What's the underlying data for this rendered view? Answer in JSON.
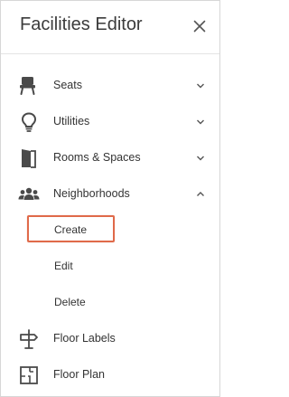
{
  "header": {
    "title": "Facilities Editor",
    "close_icon": "close-icon"
  },
  "nav": {
    "items": [
      {
        "label": "Seats",
        "icon": "seat-icon",
        "expanded": false
      },
      {
        "label": "Utilities",
        "icon": "lightbulb-icon",
        "expanded": false
      },
      {
        "label": "Rooms & Spaces",
        "icon": "door-icon",
        "expanded": false
      },
      {
        "label": "Neighborhoods",
        "icon": "people-icon",
        "expanded": true
      },
      {
        "label": "Floor Labels",
        "icon": "signpost-icon",
        "expanded": null
      },
      {
        "label": "Floor Plan",
        "icon": "floor-plan-icon",
        "expanded": null
      }
    ],
    "neighborhoods_sub": [
      {
        "label": "Create",
        "highlighted": true
      },
      {
        "label": "Edit",
        "highlighted": false
      },
      {
        "label": "Delete",
        "highlighted": false
      }
    ]
  },
  "colors": {
    "highlight_border": "#e06a4a",
    "icon": "#4a4a4a",
    "text": "#333333"
  }
}
